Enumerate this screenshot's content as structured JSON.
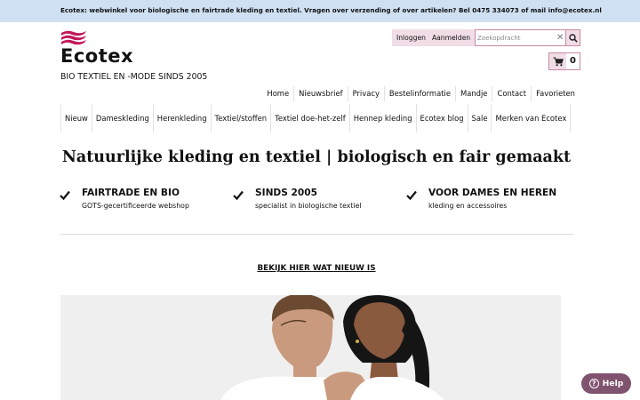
{
  "topbar": {
    "text": "Ecotex: webwinkel voor biologische en fairtrade kleding en textiel. Vragen over verzending of over artikelen? Bel 0475 334073 of mail info@ecotex.nl"
  },
  "brand": {
    "name": "Ecotex",
    "tagline": "BIO TEXTIEL EN -MODE SINDS 2005",
    "accent_color": "#c2185b",
    "logo_icon": "flag-logo-icon"
  },
  "account": {
    "login_label": "Inloggen",
    "register_label": "Aanmelden"
  },
  "search": {
    "placeholder": "Zoekopdracht",
    "value": "",
    "clear_icon": "close-icon",
    "button_icon": "search-icon"
  },
  "cart": {
    "icon": "cart-icon",
    "count": "0"
  },
  "utility_nav": {
    "items": [
      {
        "label": "Home"
      },
      {
        "label": "Nieuwsbrief"
      },
      {
        "label": "Privacy"
      },
      {
        "label": "Bestelinformatie"
      },
      {
        "label": "Mandje"
      },
      {
        "label": "Contact"
      },
      {
        "label": "Favorieten"
      }
    ]
  },
  "main_nav": {
    "items": [
      {
        "label": "Nieuw"
      },
      {
        "label": "Dameskleding"
      },
      {
        "label": "Herenkleding"
      },
      {
        "label": "Textiel/stoffen"
      },
      {
        "label": "Textiel doe-het-zelf"
      },
      {
        "label": "Hennep kleding"
      },
      {
        "label": "Ecotex blog"
      },
      {
        "label": "Sale"
      },
      {
        "label": "Merken van Ecotex"
      }
    ]
  },
  "hero": {
    "headline": "Natuurlijke kleding en textiel | biologisch en fair gemaakt",
    "new_link": "BEKIJK HIER WAT NIEUW IS"
  },
  "usps": [
    {
      "title": "FAIRTRADE EN BIO",
      "subtitle": "GOTS-gecertificeerde webshop",
      "icon": "check-icon"
    },
    {
      "title": "SINDS 2005",
      "subtitle": "specialist in biologische textiel",
      "icon": "check-icon"
    },
    {
      "title": "VOOR DAMES EN HEREN",
      "subtitle": "kleding en accessoires",
      "icon": "check-icon"
    }
  ],
  "help": {
    "label": "Help",
    "icon": "question-circle-icon",
    "color": "#80536f"
  }
}
